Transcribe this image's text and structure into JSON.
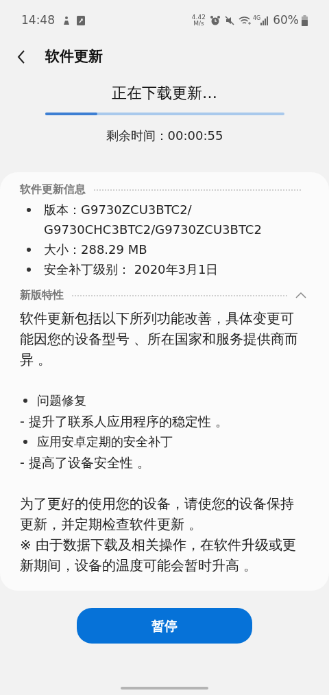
{
  "status_bar": {
    "time": "14:48",
    "speed_value": "4.42",
    "speed_unit": "M/s",
    "network": "4G",
    "battery": "60%"
  },
  "header": {
    "title": "软件更新"
  },
  "download": {
    "title": "正在下载更新…",
    "level": 0.22,
    "remaining": "剩余时间：00:00:55"
  },
  "info": {
    "heading": "软件更新信息",
    "items": [
      {
        "text": "版本：G9730ZCU3BTC2/\nG9730CHC3BTC2/G9730ZCU3BTC2"
      },
      {
        "text": "大小：288.29 MB"
      },
      {
        "text": "安全补丁级别： 2020年3月1日"
      }
    ]
  },
  "features": {
    "heading": "新版特性",
    "expanded": true,
    "lines": [
      {
        "kind": "paragraph",
        "text": "软件更新包括以下所列功能改善，具体变更可能因您的设备型号 、所在国家和服务提供商而异 。"
      },
      {
        "kind": "bullet",
        "text": "问题修复"
      },
      {
        "kind": "dash",
        "text": "- 提升了联系人应用程序的稳定性 。"
      },
      {
        "kind": "bullet",
        "text": "应用安卓定期的安全补丁"
      },
      {
        "kind": "dash",
        "text": "- 提高了设备安全性 。"
      },
      {
        "kind": "paragraph",
        "text": "为了更好的使用您的设备，请使您的设备保持更新，并定期检查软件更新 。"
      },
      {
        "kind": "paragraph",
        "text": "※ 由于数据下载及相关操作，在软件升级或更新期间，设备的温度可能会暂时升高 。"
      }
    ]
  },
  "pause_button": "暂停"
}
